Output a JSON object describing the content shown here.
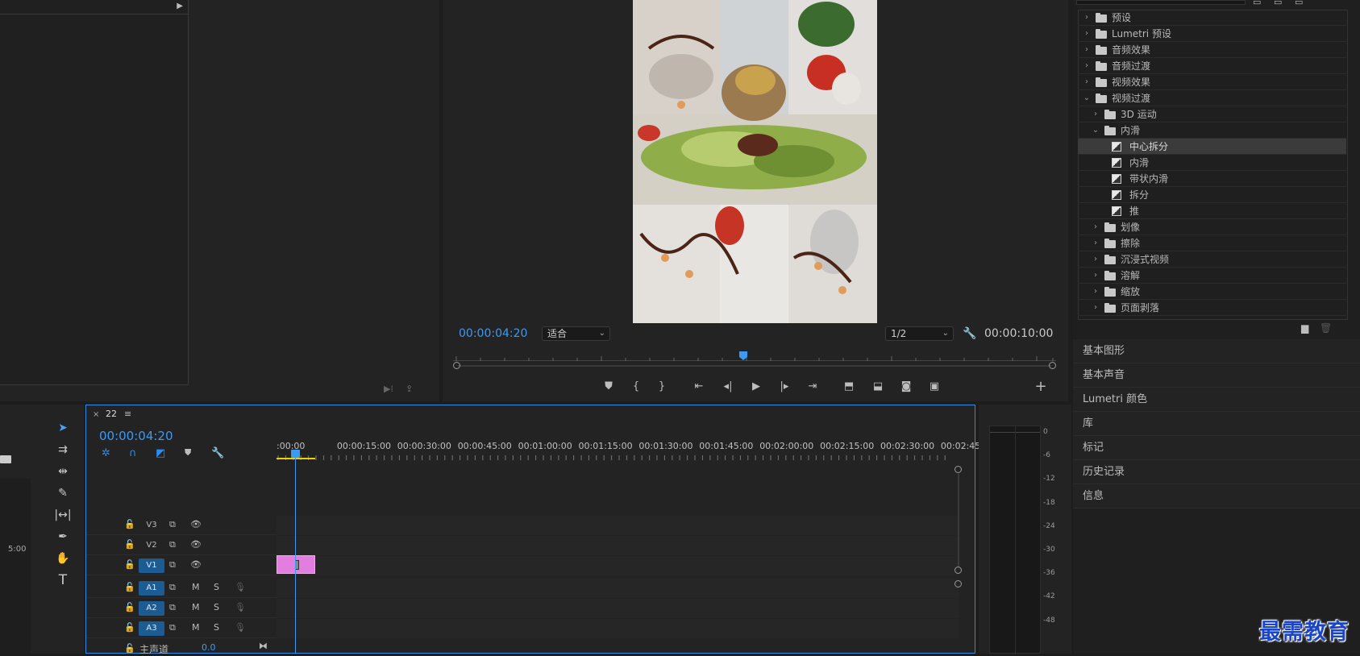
{
  "program": {
    "timecode_current": "00:00:04:20",
    "fit": "适合",
    "resolution": "1/2",
    "timecode_duration": "00:00:10:00"
  },
  "effects": {
    "items": [
      {
        "label": "预设",
        "depth": 0,
        "kind": "folder",
        "state": "collapsed"
      },
      {
        "label": "Lumetri 预设",
        "depth": 0,
        "kind": "folder",
        "state": "collapsed"
      },
      {
        "label": "音频效果",
        "depth": 0,
        "kind": "folder",
        "state": "collapsed"
      },
      {
        "label": "音频过渡",
        "depth": 0,
        "kind": "folder",
        "state": "collapsed"
      },
      {
        "label": "视频效果",
        "depth": 0,
        "kind": "folder",
        "state": "collapsed"
      },
      {
        "label": "视频过渡",
        "depth": 0,
        "kind": "folder",
        "state": "expanded"
      },
      {
        "label": "3D 运动",
        "depth": 1,
        "kind": "folder",
        "state": "collapsed"
      },
      {
        "label": "内滑",
        "depth": 1,
        "kind": "folder",
        "state": "expanded"
      },
      {
        "label": "中心拆分",
        "depth": 2,
        "kind": "transition",
        "selected": true
      },
      {
        "label": "内滑",
        "depth": 2,
        "kind": "transition"
      },
      {
        "label": "带状内滑",
        "depth": 2,
        "kind": "transition"
      },
      {
        "label": "拆分",
        "depth": 2,
        "kind": "transition"
      },
      {
        "label": "推",
        "depth": 2,
        "kind": "transition"
      },
      {
        "label": "划像",
        "depth": 1,
        "kind": "folder",
        "state": "collapsed"
      },
      {
        "label": "擦除",
        "depth": 1,
        "kind": "folder",
        "state": "collapsed"
      },
      {
        "label": "沉浸式视频",
        "depth": 1,
        "kind": "folder",
        "state": "collapsed"
      },
      {
        "label": "溶解",
        "depth": 1,
        "kind": "folder",
        "state": "collapsed"
      },
      {
        "label": "缩放",
        "depth": 1,
        "kind": "folder",
        "state": "collapsed"
      },
      {
        "label": "页面剥落",
        "depth": 1,
        "kind": "folder",
        "state": "collapsed"
      }
    ]
  },
  "panels": [
    "基本图形",
    "基本声音",
    "Lumetri 颜色",
    "库",
    "标记",
    "历史记录",
    "信息"
  ],
  "timeline": {
    "sequence_name": "22",
    "timecode": "00:00:04:20",
    "ruler_labels": [
      ":00:00",
      "00:00:15:00",
      "00:00:30:00",
      "00:00:45:00",
      "00:01:00:00",
      "00:01:15:00",
      "00:01:30:00",
      "00:01:45:00",
      "00:02:00:00",
      "00:02:15:00",
      "00:02:30:00",
      "00:02:45:"
    ],
    "tracks": [
      {
        "name": "V3",
        "type": "video",
        "active": false
      },
      {
        "name": "V2",
        "type": "video",
        "active": false
      },
      {
        "name": "V1",
        "type": "video",
        "active": true
      },
      {
        "name": "A1",
        "type": "audio",
        "active": true
      },
      {
        "name": "A2",
        "type": "audio",
        "active": true
      },
      {
        "name": "A3",
        "type": "audio",
        "active": true
      }
    ],
    "master_label": "主声道",
    "master_value": "0.0",
    "mute_label": "M",
    "solo_label": "S",
    "clip_color": "#e27ee0"
  },
  "source": {
    "left_timecode": "5:00"
  },
  "meter": {
    "db_labels": [
      "0",
      "-6",
      "-12",
      "-18",
      "-24",
      "-30",
      "-36",
      "-42",
      "-48"
    ]
  },
  "watermark": "最需教育",
  "colors": {
    "accent": "#2d8ceb",
    "selection": "#3b3b3b"
  }
}
